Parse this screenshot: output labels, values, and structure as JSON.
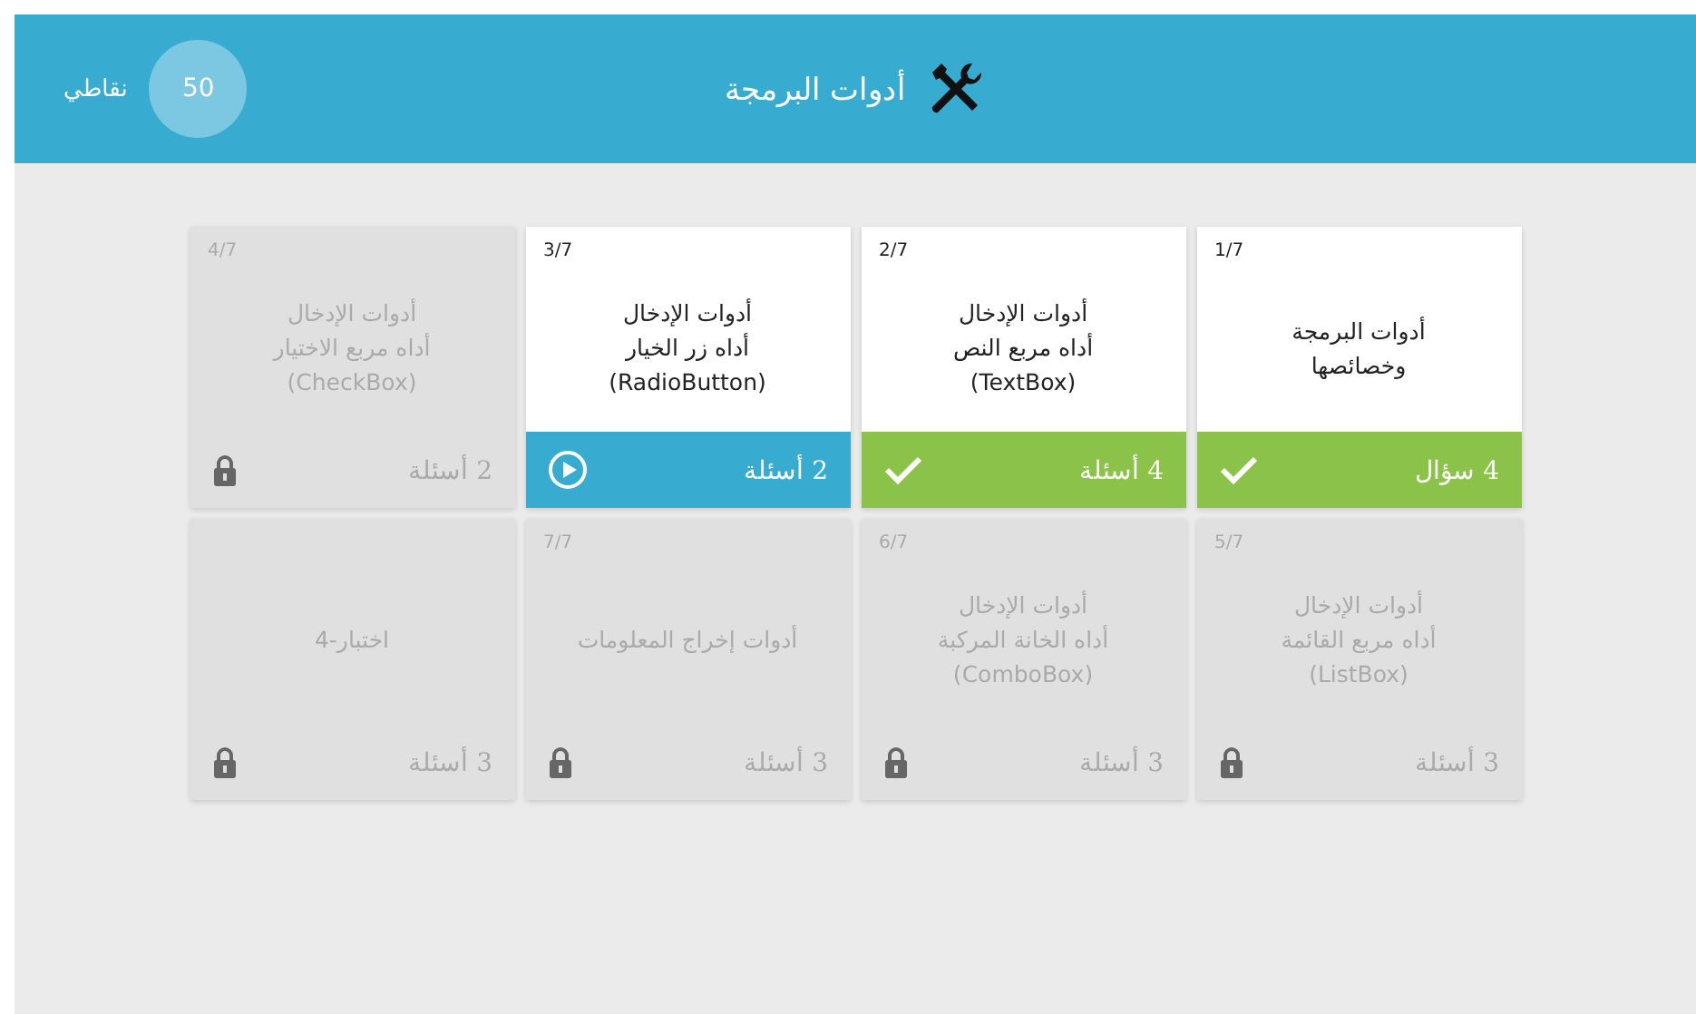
{
  "header": {
    "title": "أدوات البرمجة",
    "points_label": "نقاطي",
    "points": "50"
  },
  "lessons": [
    {
      "number": "1/7",
      "title": "أدوات البرمجة\nوخصائصها",
      "count": "4 سؤال",
      "kind": "done"
    },
    {
      "number": "2/7",
      "title": "أدوات الإدخال\nأداه مربع النص\n(TextBox)",
      "count": "4 أسئلة",
      "kind": "done"
    },
    {
      "number": "3/7",
      "title": "أدوات الإدخال\nأداه زر الخيار\n(RadioButton)",
      "count": "2 أسئلة",
      "kind": "current"
    },
    {
      "number": "4/7",
      "title": "أدوات الإدخال\nأداه مربع الاختيار\n(CheckBox)",
      "count": "2 أسئلة",
      "kind": "locked"
    },
    {
      "number": "5/7",
      "title": "أدوات الإدخال\nأداه مربع القائمة\n(ListBox)",
      "count": "3 أسئلة",
      "kind": "locked"
    },
    {
      "number": "6/7",
      "title": "أدوات الإدخال\nأداه الخانة المركبة\n(ComboBox)",
      "count": "3 أسئلة",
      "kind": "locked"
    },
    {
      "number": "7/7",
      "title": "أدوات إخراج المعلومات",
      "count": "3 أسئلة",
      "kind": "locked"
    },
    {
      "title": "اختبار-4",
      "count": "3 أسئلة",
      "kind": "locked"
    }
  ]
}
